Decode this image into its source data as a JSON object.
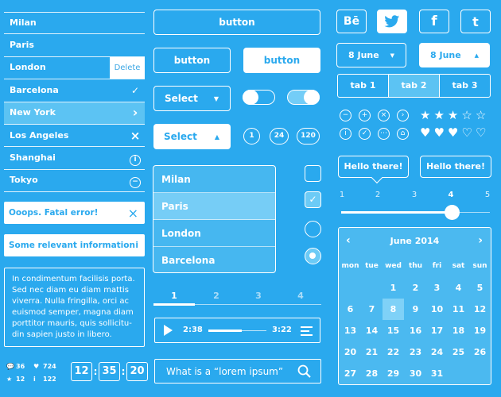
{
  "list": {
    "items": [
      {
        "label": "Milan",
        "icon": "",
        "style": "plain"
      },
      {
        "label": "Paris",
        "icon": "",
        "style": "plain"
      },
      {
        "label": "London",
        "icon": "",
        "style": "delete"
      },
      {
        "label": "Barcelona",
        "icon": "✓",
        "style": "check"
      },
      {
        "label": "New York",
        "icon": "›",
        "style": "selected"
      },
      {
        "label": "Los Angeles",
        "icon": "×",
        "style": "close"
      },
      {
        "label": "Shanghai",
        "icon": "i",
        "style": "info"
      },
      {
        "label": "Tokyo",
        "icon": "−",
        "style": "minus"
      }
    ],
    "delete_label": "Delete"
  },
  "alerts": {
    "error_text": "Ooops. Fatal error!",
    "info_text": "Some relevant information",
    "info_icon": "i"
  },
  "textbox": {
    "text": "In condimentum facilisis porta. Sed nec diam eu diam mattis viverra. Nulla fringilla, orci ac euismod semper, magna diam porttitor mauris, quis sollicitu-din sapien justo in libero."
  },
  "stats": {
    "comments": "36",
    "likes": "724",
    "favorites": "12",
    "info": "122"
  },
  "clock": {
    "h": "12",
    "m": "35",
    "s": "20"
  },
  "buttons": {
    "wide": "button",
    "outline": "button",
    "solid": "button"
  },
  "selects": {
    "closed_label": "Select",
    "open_label": "Select"
  },
  "pills": [
    "1",
    "24",
    "120"
  ],
  "dropdown": {
    "options": [
      "Milan",
      "Paris",
      "London",
      "Barcelona"
    ],
    "active_index": 1
  },
  "checks": {
    "checkbox1_checked": false,
    "checkbox2_checked": true,
    "radio1_selected": false,
    "radio2_selected": true
  },
  "pager": {
    "pages": [
      "1",
      "2",
      "3",
      "4"
    ],
    "active": "1"
  },
  "player": {
    "elapsed": "2:38",
    "total": "3:22",
    "progress": 0.58
  },
  "search": {
    "placeholder": "What is a “lorem ipsum”"
  },
  "social": {
    "behance": "Bē",
    "twitter": "twitter-icon",
    "facebook": "f",
    "tumblr": "t"
  },
  "dates": {
    "closed": "8 June",
    "open": "8 June"
  },
  "tabs": [
    "tab 1",
    "tab 2",
    "tab 3"
  ],
  "tabs_active": 1,
  "icon_row1": [
    "−",
    "+",
    "×",
    "›"
  ],
  "icon_row2": [
    "i",
    "✓",
    "⋯",
    "⌂"
  ],
  "rating": {
    "stars": 3,
    "hearts": 3,
    "max": 5
  },
  "tooltips": [
    "Hello there!",
    "Hello there!"
  ],
  "slider": {
    "ticks": [
      "1",
      "2",
      "3",
      "4",
      "5"
    ],
    "value": 4
  },
  "calendar": {
    "title": "June 2014",
    "weekdays": [
      "mon",
      "tue",
      "wed",
      "thu",
      "fri",
      "sat",
      "sun"
    ],
    "today": "8",
    "rows": [
      [
        "",
        "",
        "",
        "",
        "",
        "",
        "1"
      ],
      [
        "",
        "",
        "1",
        "2",
        "3",
        "4",
        "5"
      ],
      [
        "6",
        "7",
        "8",
        "9",
        "10",
        "11",
        "12"
      ],
      [
        "13",
        "14",
        "15",
        "16",
        "17",
        "18",
        "19"
      ],
      [
        "20",
        "21",
        "22",
        "23",
        "24",
        "25",
        "26"
      ],
      [
        "27",
        "28",
        "29",
        "30",
        "31",
        "",
        ""
      ]
    ]
  },
  "colors": {
    "background": "#2aa9ee",
    "selected": "#5cc3f3",
    "white": "#ffffff"
  }
}
